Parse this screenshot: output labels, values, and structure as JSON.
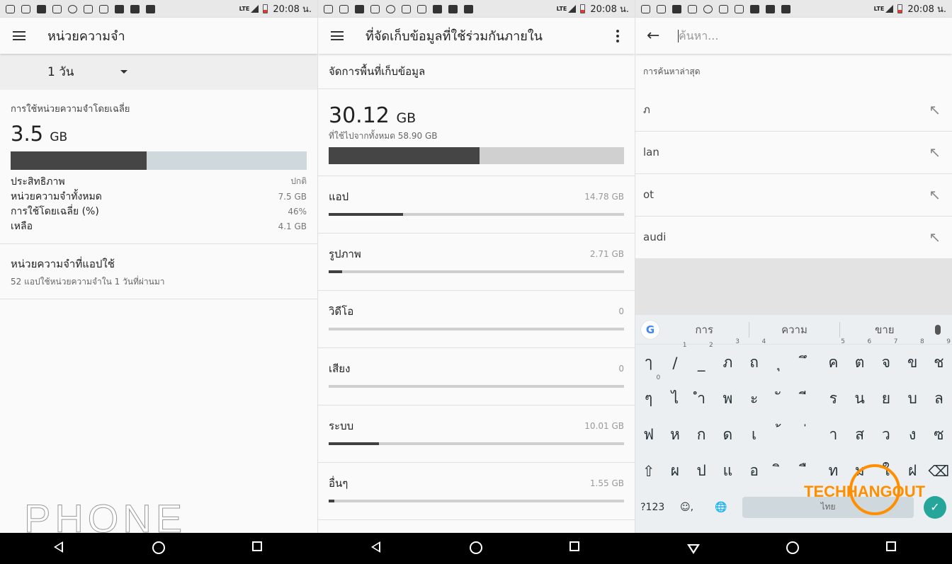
{
  "status": {
    "time": "20:08 น.",
    "network": "LTE"
  },
  "memory": {
    "title": "หน่วยความจำ",
    "period": "1 วัน",
    "avg_label": "การใช้หน่วยความจำโดยเฉลี่ย",
    "avg_value": "3.5",
    "avg_unit": "GB",
    "usage_fraction": 0.46,
    "stats": [
      {
        "label": "ประสิทธิภาพ",
        "value": "ปกติ"
      },
      {
        "label": "หน่วยความจำทั้งหมด",
        "value": "7.5 GB"
      },
      {
        "label": "การใช้โดยเฉลี่ย (%)",
        "value": "46%"
      },
      {
        "label": "เหลือ",
        "value": "4.1 GB"
      }
    ],
    "apps_title": "หน่วยความจำที่แอปใช้",
    "apps_sub": "52 แอปใช้หน่วยความจำใน 1 วันที่ผ่านมา",
    "watermark": "PHONE"
  },
  "storage": {
    "title": "ที่จัดเก็บข้อมูลที่ใช้ร่วมกันภายใน",
    "manage": "จัดการพื้นที่เก็บข้อมูล",
    "used_value": "30.12",
    "used_unit": "GB",
    "used_sub": "ที่ใช้ไปจากทั้งหมด 58.90 GB",
    "used_fraction": 0.511,
    "categories": [
      {
        "name": "แอป",
        "size": "14.78 GB",
        "fraction": 0.251
      },
      {
        "name": "รูปภาพ",
        "size": "2.71 GB",
        "fraction": 0.046
      },
      {
        "name": "วิดีโอ",
        "size": "0",
        "fraction": 0
      },
      {
        "name": "เสียง",
        "size": "0",
        "fraction": 0
      },
      {
        "name": "ระบบ",
        "size": "10.01 GB",
        "fraction": 0.17
      },
      {
        "name": "อื่นๆ",
        "size": "1.55 GB",
        "fraction": 0.02
      }
    ]
  },
  "search": {
    "placeholder": "ค้นหา...",
    "recent_header": "การค้นหาล่าสุด",
    "recent": [
      "ภ",
      "lan",
      "ot",
      "audi"
    ]
  },
  "keyboard": {
    "suggestions": [
      "การ",
      "ความ",
      "ขาย"
    ],
    "row1": [
      "ๅ",
      "/",
      "_",
      "ภ",
      "ถ",
      "ุ",
      "ึ",
      "ค",
      "ต",
      "จ",
      "ข",
      "ช"
    ],
    "row1_hints": [
      "",
      "1",
      "2",
      "3",
      "4",
      "",
      "",
      "5",
      "6",
      "7",
      "8",
      "9"
    ],
    "row2": [
      "ๆ",
      "ไ",
      "ำ",
      "พ",
      "ะ",
      "ั",
      "ี",
      "ร",
      "น",
      "ย",
      "บ",
      "ล"
    ],
    "row2_hints": [
      "0",
      "",
      "",
      "",
      "",
      "",
      "",
      "",
      "",
      "",
      "",
      ""
    ],
    "row3": [
      "ฟ",
      "ห",
      "ก",
      "ด",
      "เ",
      "้",
      "่",
      "า",
      "ส",
      "ว",
      "ง",
      "ซ"
    ],
    "row4": [
      "ผ",
      "ป",
      "แ",
      "อ",
      "ิ",
      "ื",
      "ท",
      "ม",
      "ใ",
      "ฝ"
    ],
    "symbols": "?123",
    "space_label": "ไทย",
    "logo_text": "TECHHANGOUT"
  }
}
